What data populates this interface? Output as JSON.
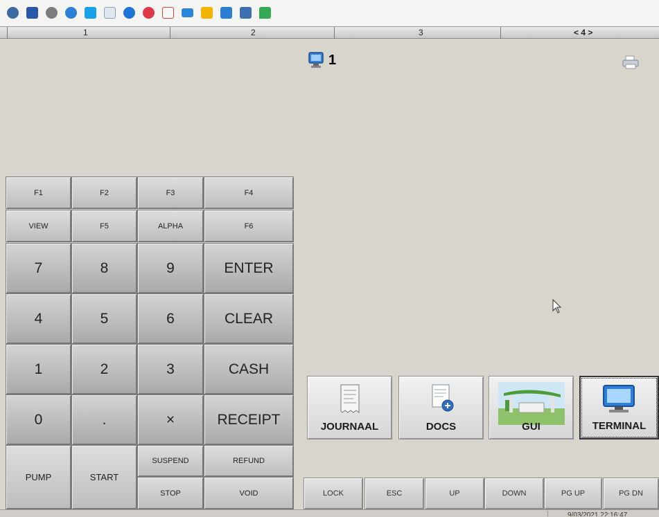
{
  "toolbar": {
    "icons": [
      {
        "name": "network-gear-icon",
        "color": "#3b6aa0"
      },
      {
        "name": "fullscreen-icon",
        "color": "#2a57a8"
      },
      {
        "name": "settings-icon",
        "color": "#6d6d6d"
      },
      {
        "name": "refresh-icon",
        "color": "#2d7fd8"
      },
      {
        "name": "windows-icon",
        "color": "#1aa0e8"
      },
      {
        "name": "window-icon",
        "color": "#9bb4cc"
      },
      {
        "name": "info-icon",
        "color": "#1e73d6"
      },
      {
        "name": "close-icon",
        "color": "#e0384b"
      },
      {
        "name": "document-icon",
        "color": "#c9463d"
      },
      {
        "name": "monitor-icon",
        "color": "#2a86d8"
      },
      {
        "name": "folder-icon",
        "color": "#f2b400"
      },
      {
        "name": "camera-icon",
        "color": "#2a7fd0"
      },
      {
        "name": "remote-desktop-icon",
        "color": "#3e6fb0"
      },
      {
        "name": "chat-icon",
        "color": "#34a853"
      }
    ]
  },
  "ruler": {
    "marks": [
      "1",
      "2",
      "3",
      "< 4 >"
    ]
  },
  "station": {
    "label": "1",
    "icon": "monitor-station-icon"
  },
  "printer": {
    "icon": "printer-icon"
  },
  "keypad": {
    "f1": "F1",
    "f2": "F2",
    "f3": "F3",
    "f4": "F4",
    "view": "VIEW",
    "f5": "F5",
    "alpha": "ALPHA",
    "f6": "F6",
    "k7": "7",
    "k8": "8",
    "k9": "9",
    "enter": "ENTER",
    "k4": "4",
    "k5": "5",
    "k6": "6",
    "clear": "CLEAR",
    "k1": "1",
    "k2": "2",
    "k3": "3",
    "cash": "CASH",
    "k0": "0",
    "dot": ".",
    "times": "×",
    "receipt": "RECEIPT",
    "pump": "PUMP",
    "start": "START",
    "suspend": "SUSPEND",
    "refund": "REFUND",
    "stop": "STOP",
    "void": "VOID"
  },
  "tiles": {
    "journaal": "JOURNAAL",
    "docs": "DOCS",
    "gui": "GUI",
    "terminal": "TERMINAL"
  },
  "nav": {
    "lock": "LOCK",
    "esc": "ESC",
    "up": "UP",
    "down": "DOWN",
    "pgup": "PG UP",
    "pgdn": "PG DN"
  },
  "status": {
    "datetime": "9/03/2021 22:16:47"
  }
}
